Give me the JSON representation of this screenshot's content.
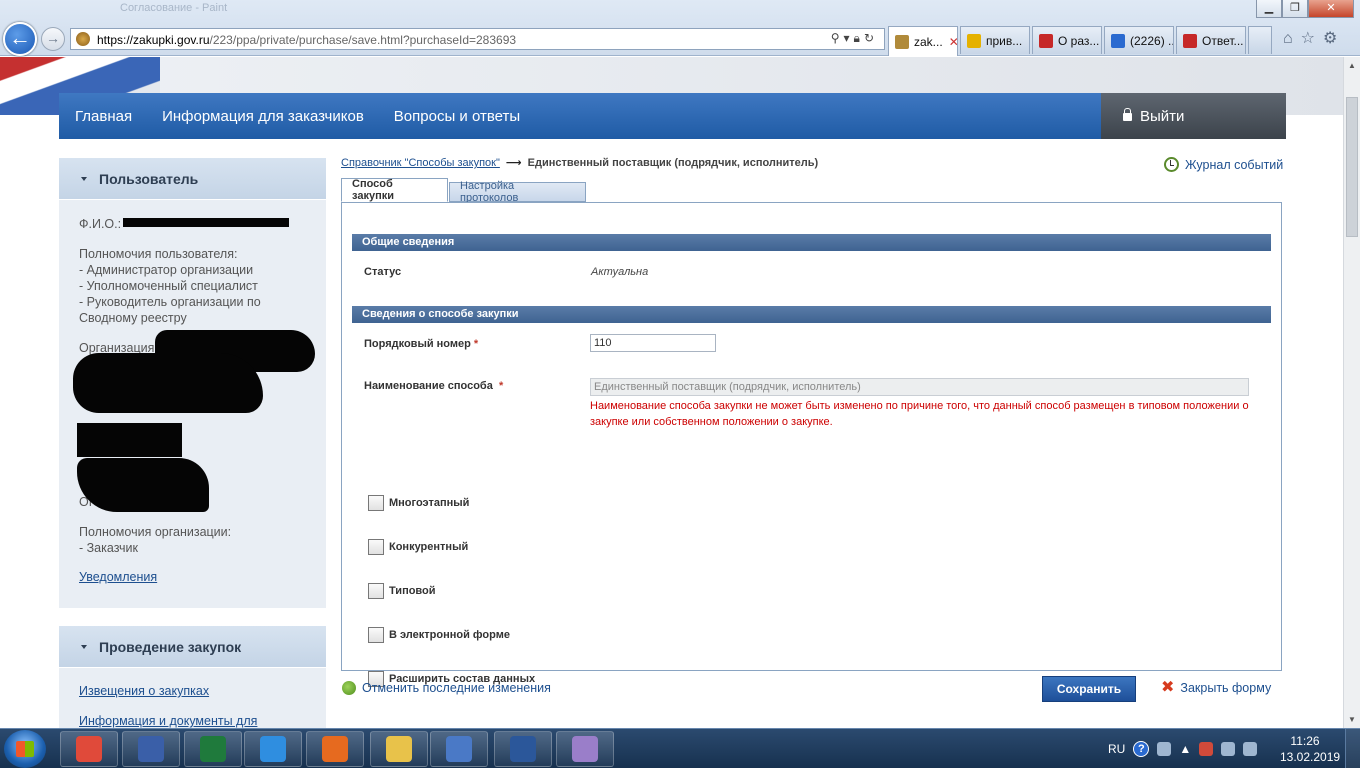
{
  "browser": {
    "window_title": "Согласование - Paint",
    "url_host": "https://zakupki.gov.ru",
    "url_path": "/223/ppa/private/purchase/save.html?purchaseId=283693",
    "tabs": [
      {
        "label": "zak...",
        "active": true,
        "favicon_color": "#b08a3a"
      },
      {
        "label": "прив...",
        "active": false,
        "favicon_color": "#e5b100"
      },
      {
        "label": "О раз...",
        "active": false,
        "favicon_color": "#c62828"
      },
      {
        "label": "(2226) ...",
        "active": false,
        "favicon_color": "#2a6ad0"
      },
      {
        "label": "Ответ...",
        "active": false,
        "favicon_color": "#c62828"
      }
    ],
    "close_tab_glyph": "✕"
  },
  "nav": {
    "items": [
      "Главная",
      "Информация для заказчиков",
      "Вопросы и ответы"
    ],
    "logout": "Выйти"
  },
  "sidebar": {
    "user_title": "Пользователь",
    "fio_label": "Ф.И.О.:",
    "permissions_title": "Полномочия пользователя:",
    "permissions": [
      "- Администратор организации",
      "- Уполномоченный специалист",
      "- Руководитель организации по",
      "Сводному реестру"
    ],
    "org_label": "Организация:",
    "ogrn_label": "ОГ",
    "org_permissions_title": "Полномочия организации:",
    "org_permissions": [
      "- Заказчик"
    ],
    "notifications_link": "Уведомления",
    "procurement_title": "Проведение закупок",
    "procurement_links": [
      "Извещения о закупках",
      "Информация и документы для"
    ]
  },
  "breadcrumb": {
    "link": "Справочник \"Способы закупок\"",
    "arrow": "⟶",
    "current": "Единственный поставщик (подрядчик, исполнитель)"
  },
  "journal_link": "Журнал событий",
  "form_tabs": [
    "Способ закупки",
    "Настройка протоколов"
  ],
  "form": {
    "section_general": "Общие сведения",
    "status_label": "Статус",
    "status_value": "Актуальна",
    "section_method": "Сведения о способе закупки",
    "order_label": "Порядковый номер",
    "order_value": "110",
    "name_label": "Наименование способа",
    "name_value": "Единственный поставщик (подрядчик, исполнитель)",
    "name_warning": "Наименование способа закупки не может быть изменено по причине того, что данный способ размещен в типовом положении о закупке или собственном положении о закупке.",
    "required_mark": "*",
    "checkboxes": [
      {
        "label": "Многоэтапный",
        "checked": false
      },
      {
        "label": "Конкурентный",
        "checked": false
      },
      {
        "label": "Типовой",
        "checked": false
      },
      {
        "label": "В электронной форме",
        "checked": false
      },
      {
        "label": "Расширить состав данных",
        "checked": false
      }
    ]
  },
  "actions": {
    "revert": "Отменить последние изменения",
    "save": "Сохранить",
    "close": "Закрыть форму",
    "close_glyph": "✖"
  },
  "taskbar": {
    "apps": [
      {
        "name": "chrome",
        "color": "#e04a3a"
      },
      {
        "name": "floppy-save",
        "color": "#3a5fa8"
      },
      {
        "name": "excel",
        "color": "#1f7a3c"
      },
      {
        "name": "internet-explorer",
        "color": "#2f8ee0"
      },
      {
        "name": "firefox",
        "color": "#e66a1f"
      },
      {
        "name": "file-explorer",
        "color": "#e8c24a"
      },
      {
        "name": "scanner",
        "color": "#4a79c6"
      },
      {
        "name": "word",
        "color": "#2b579a"
      },
      {
        "name": "paint",
        "color": "#9a7ec9"
      }
    ],
    "lang": "RU",
    "help": "?",
    "time": "11:26",
    "date": "13.02.2019"
  }
}
